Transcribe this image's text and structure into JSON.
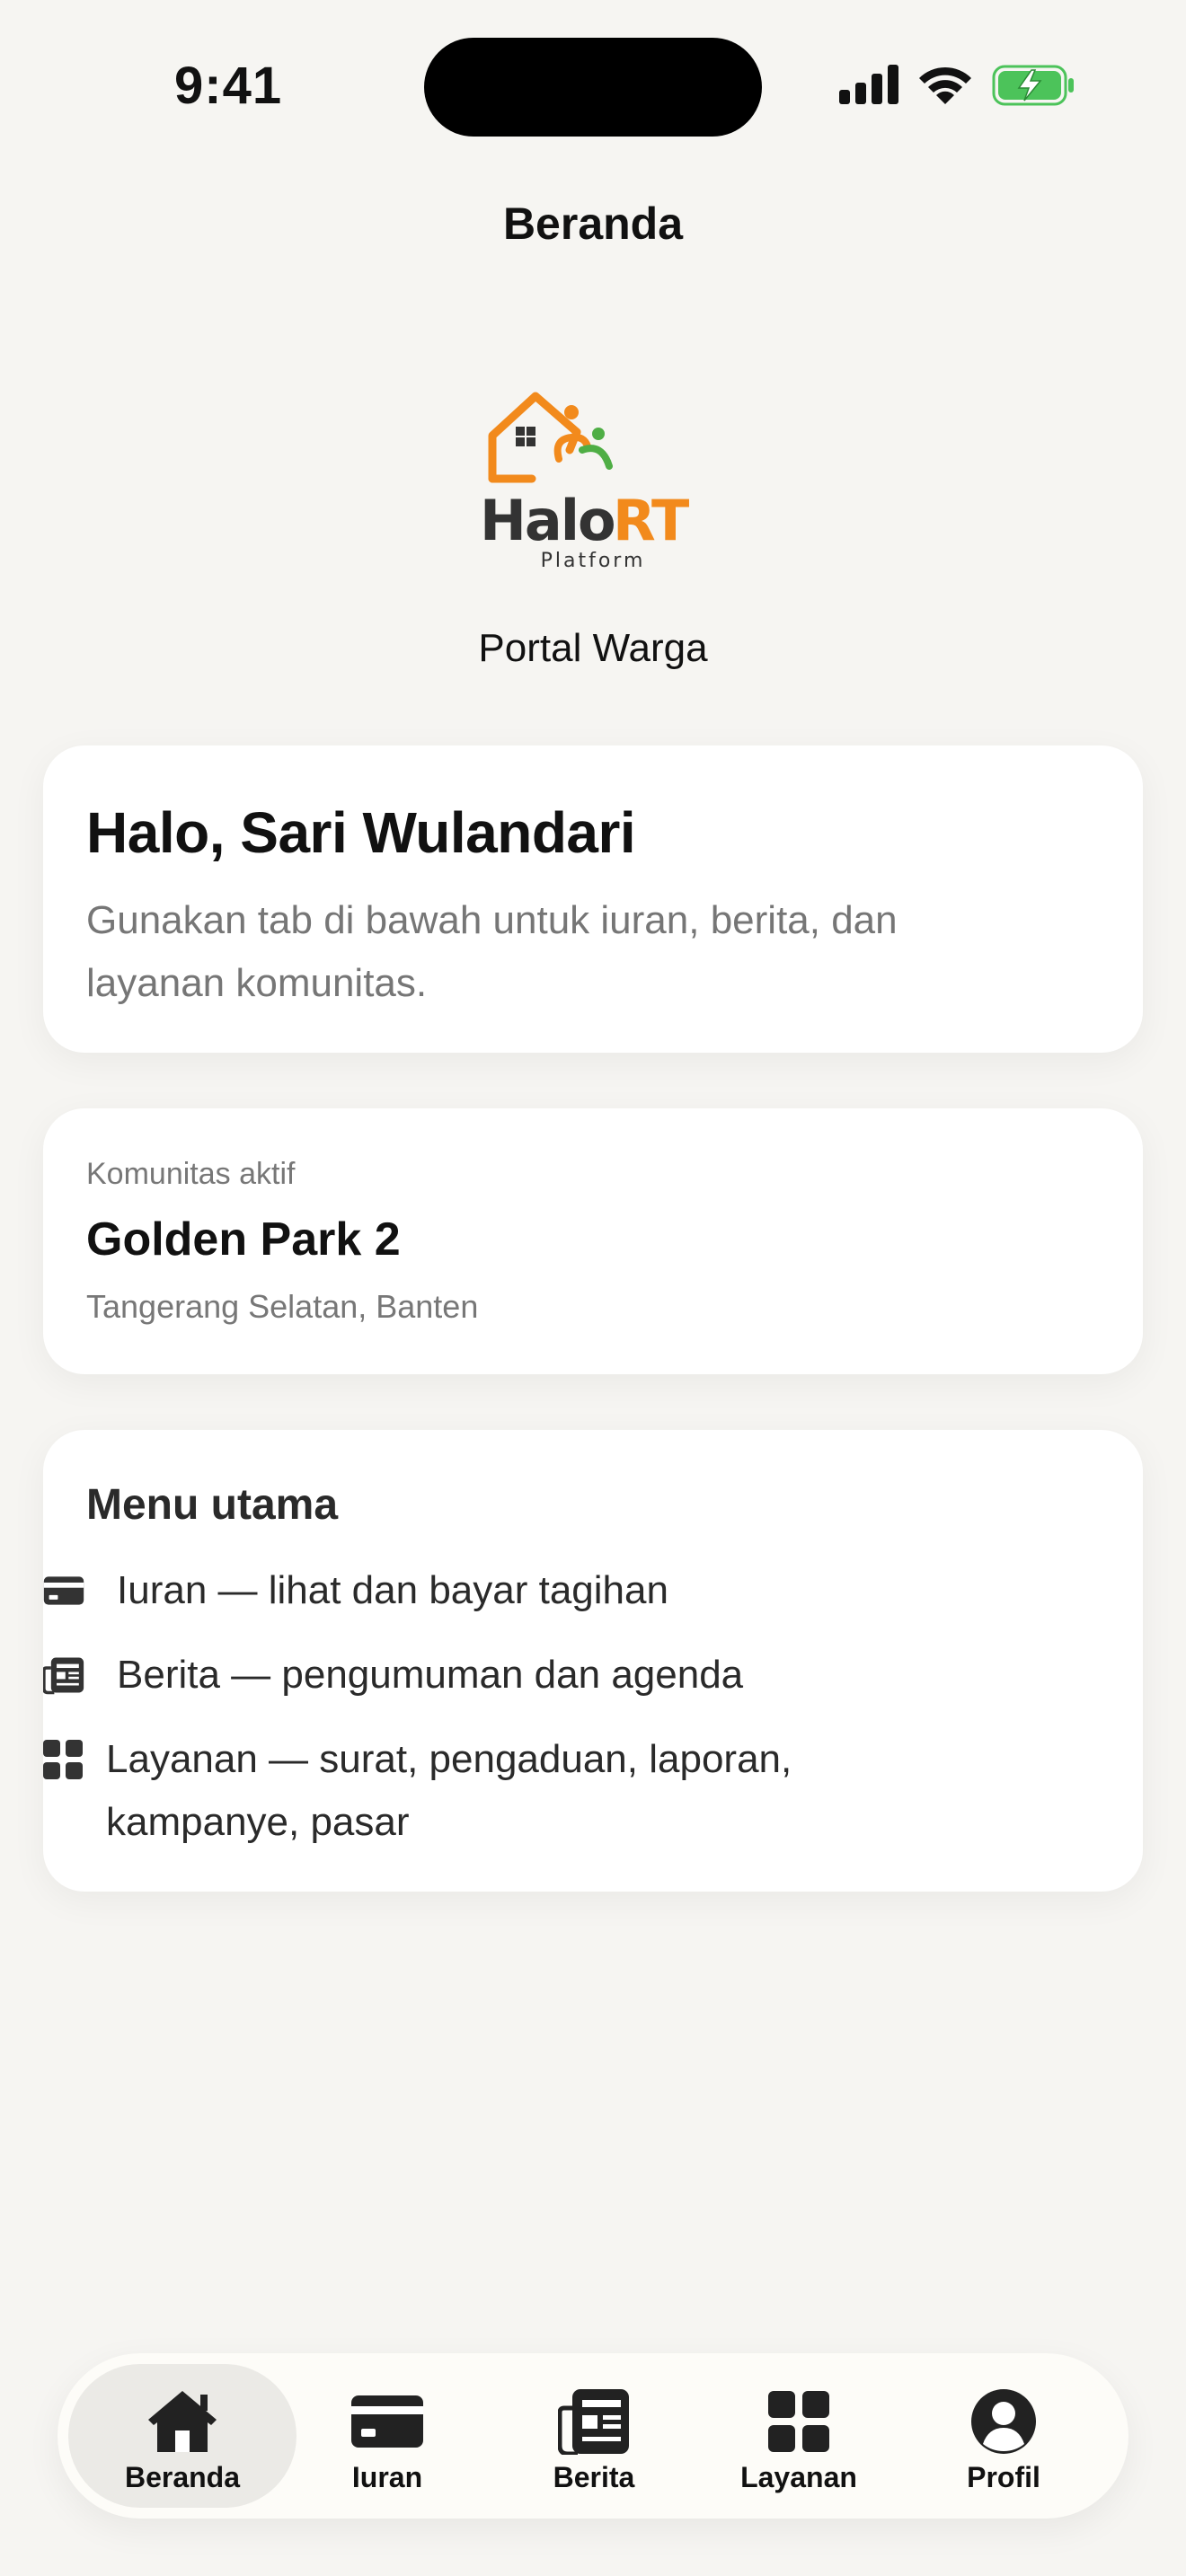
{
  "status": {
    "time": "9:41"
  },
  "header": {
    "title": "Beranda"
  },
  "logo": {
    "brand_part1": "Halo",
    "brand_part2": "RT",
    "tagline": "Platform",
    "subtitle": "Portal Warga"
  },
  "greeting": {
    "title": "Halo, Sari Wulandari",
    "description": "Gunakan tab di bawah untuk iuran, berita, dan layanan komunitas."
  },
  "community": {
    "label": "Komunitas aktif",
    "name": "Golden Park 2",
    "location": "Tangerang Selatan, Banten"
  },
  "menu": {
    "title": "Menu utama",
    "items": [
      {
        "icon": "credit-card-icon",
        "label": "Iuran — lihat dan bayar tagihan"
      },
      {
        "icon": "newspaper-icon",
        "label": "Berita — pengumuman dan agenda"
      },
      {
        "icon": "grid-icon",
        "label": "Layanan — surat, pengaduan, laporan, kampanye, pasar"
      }
    ]
  },
  "tabs": [
    {
      "icon": "home-icon",
      "label": "Beranda",
      "active": true
    },
    {
      "icon": "credit-card-icon",
      "label": "Iuran",
      "active": false
    },
    {
      "icon": "newspaper-icon",
      "label": "Berita",
      "active": false
    },
    {
      "icon": "grid-icon",
      "label": "Layanan",
      "active": false
    },
    {
      "icon": "person-icon",
      "label": "Profil",
      "active": false
    }
  ],
  "colors": {
    "brand_orange": "#f28a1c",
    "brand_green": "#4fae45",
    "background": "#f6f5f2",
    "battery_green": "#4cc35a"
  }
}
